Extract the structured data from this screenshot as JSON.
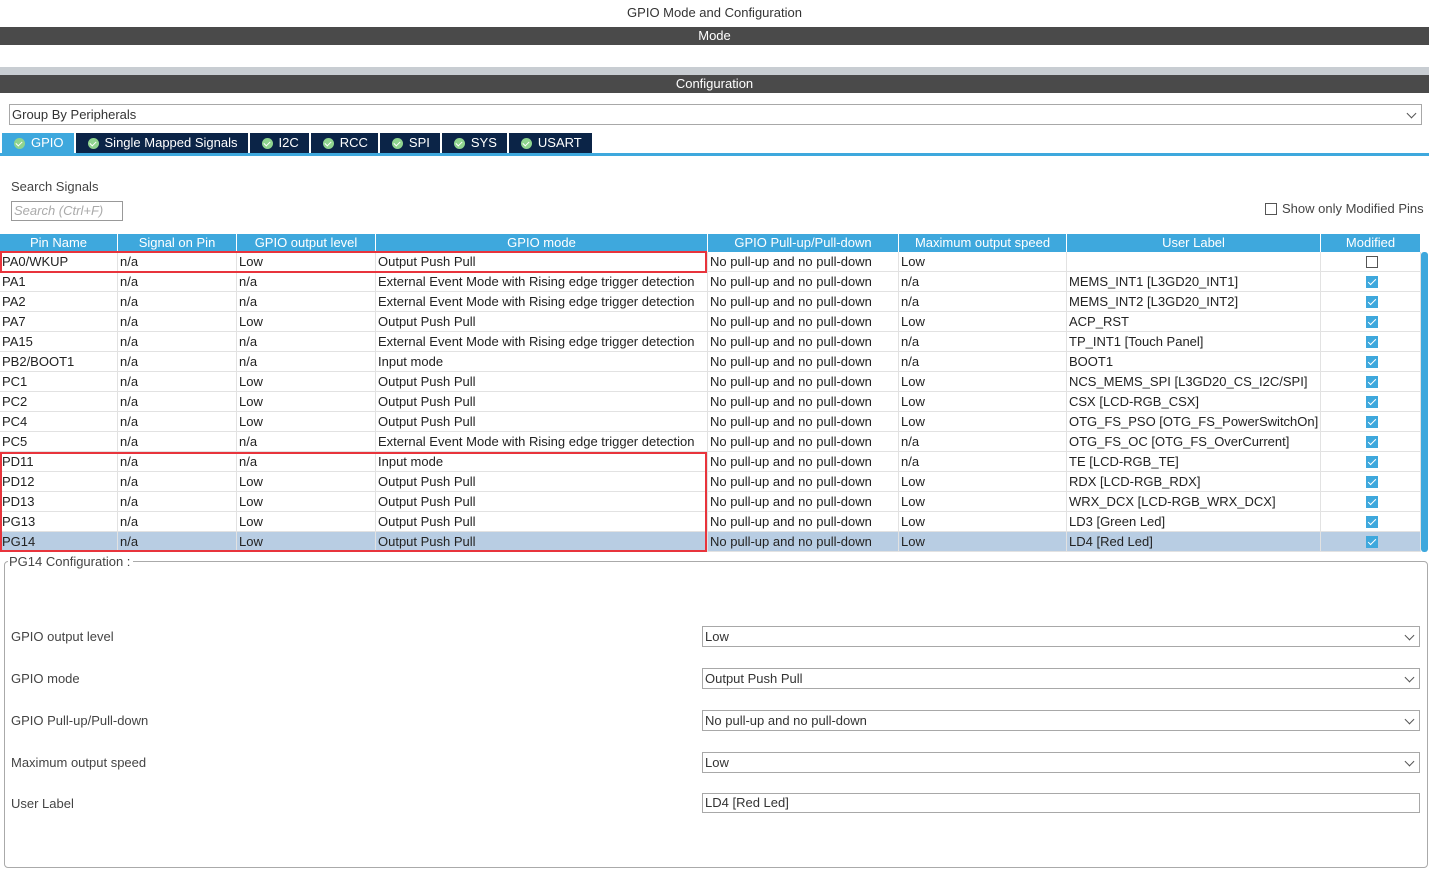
{
  "window_title": "GPIO Mode and Configuration",
  "mode_header": "Mode",
  "config_header": "Configuration",
  "group_by": "Group By Peripherals",
  "tabs": [
    {
      "label": "GPIO",
      "active": true
    },
    {
      "label": "Single Mapped Signals"
    },
    {
      "label": "I2C"
    },
    {
      "label": "RCC"
    },
    {
      "label": "SPI"
    },
    {
      "label": "SYS"
    },
    {
      "label": "USART"
    }
  ],
  "search": {
    "label": "Search Signals",
    "placeholder": "Search (Ctrl+F)"
  },
  "show_modified": {
    "label": "Show only Modified Pins",
    "checked": false
  },
  "columns": [
    "Pin Name",
    "Signal on Pin",
    "GPIO output level",
    "GPIO mode",
    "GPIO Pull-up/Pull-down",
    "Maximum output speed",
    "User Label",
    "Modified"
  ],
  "rows": [
    {
      "pin": "PA0/WKUP",
      "signal": "n/a",
      "level": "Low",
      "mode": "Output Push Pull",
      "pull": "No pull-up and no pull-down",
      "speed": "Low",
      "label": "",
      "modified": false
    },
    {
      "pin": "PA1",
      "signal": "n/a",
      "level": "n/a",
      "mode": "External Event Mode with Rising edge trigger detection",
      "pull": "No pull-up and no pull-down",
      "speed": "n/a",
      "label": "MEMS_INT1 [L3GD20_INT1]",
      "modified": true
    },
    {
      "pin": "PA2",
      "signal": "n/a",
      "level": "n/a",
      "mode": "External Event Mode with Rising edge trigger detection",
      "pull": "No pull-up and no pull-down",
      "speed": "n/a",
      "label": "MEMS_INT2 [L3GD20_INT2]",
      "modified": true
    },
    {
      "pin": "PA7",
      "signal": "n/a",
      "level": "Low",
      "mode": "Output Push Pull",
      "pull": "No pull-up and no pull-down",
      "speed": "Low",
      "label": "ACP_RST",
      "modified": true
    },
    {
      "pin": "PA15",
      "signal": "n/a",
      "level": "n/a",
      "mode": "External Event Mode with Rising edge trigger detection",
      "pull": "No pull-up and no pull-down",
      "speed": "n/a",
      "label": "TP_INT1 [Touch Panel]",
      "modified": true
    },
    {
      "pin": "PB2/BOOT1",
      "signal": "n/a",
      "level": "n/a",
      "mode": "Input mode",
      "pull": "No pull-up and no pull-down",
      "speed": "n/a",
      "label": "BOOT1",
      "modified": true
    },
    {
      "pin": "PC1",
      "signal": "n/a",
      "level": "Low",
      "mode": "Output Push Pull",
      "pull": "No pull-up and no pull-down",
      "speed": "Low",
      "label": "NCS_MEMS_SPI [L3GD20_CS_I2C/SPI]",
      "modified": true
    },
    {
      "pin": "PC2",
      "signal": "n/a",
      "level": "Low",
      "mode": "Output Push Pull",
      "pull": "No pull-up and no pull-down",
      "speed": "Low",
      "label": "CSX [LCD-RGB_CSX]",
      "modified": true
    },
    {
      "pin": "PC4",
      "signal": "n/a",
      "level": "Low",
      "mode": "Output Push Pull",
      "pull": "No pull-up and no pull-down",
      "speed": "Low",
      "label": "OTG_FS_PSO [OTG_FS_PowerSwitchOn]",
      "modified": true
    },
    {
      "pin": "PC5",
      "signal": "n/a",
      "level": "n/a",
      "mode": "External Event Mode with Rising edge trigger detection",
      "pull": "No pull-up and no pull-down",
      "speed": "n/a",
      "label": "OTG_FS_OC [OTG_FS_OverCurrent]",
      "modified": true
    },
    {
      "pin": "PD11",
      "signal": "n/a",
      "level": "n/a",
      "mode": "Input mode",
      "pull": "No pull-up and no pull-down",
      "speed": "n/a",
      "label": "TE [LCD-RGB_TE]",
      "modified": true
    },
    {
      "pin": "PD12",
      "signal": "n/a",
      "level": "Low",
      "mode": "Output Push Pull",
      "pull": "No pull-up and no pull-down",
      "speed": "Low",
      "label": "RDX [LCD-RGB_RDX]",
      "modified": true
    },
    {
      "pin": "PD13",
      "signal": "n/a",
      "level": "Low",
      "mode": "Output Push Pull",
      "pull": "No pull-up and no pull-down",
      "speed": "Low",
      "label": "WRX_DCX [LCD-RGB_WRX_DCX]",
      "modified": true
    },
    {
      "pin": "PG13",
      "signal": "n/a",
      "level": "Low",
      "mode": "Output Push Pull",
      "pull": "No pull-up and no pull-down",
      "speed": "Low",
      "label": "LD3 [Green Led]",
      "modified": true
    },
    {
      "pin": "PG14",
      "signal": "n/a",
      "level": "Low",
      "mode": "Output Push Pull",
      "pull": "No pull-up and no pull-down",
      "speed": "Low",
      "label": "LD4 [Red Led]",
      "modified": true,
      "selected": true
    }
  ],
  "config": {
    "title": "PG14 Configuration :",
    "fields": [
      {
        "label": "GPIO output level",
        "value": "Low",
        "type": "select"
      },
      {
        "label": "GPIO mode",
        "value": "Output Push Pull",
        "type": "select"
      },
      {
        "label": "GPIO Pull-up/Pull-down",
        "value": "No pull-up and no pull-down",
        "type": "select"
      },
      {
        "label": "Maximum output speed",
        "value": "Low",
        "type": "select"
      },
      {
        "label": "User Label",
        "value": "LD4 [Red Led]",
        "type": "text"
      }
    ]
  },
  "colors": {
    "header_blue": "#3ea8dd",
    "tab_navy": "#0b2447",
    "selected_row": "#b8cde3",
    "highlight_red": "#e8343c"
  }
}
